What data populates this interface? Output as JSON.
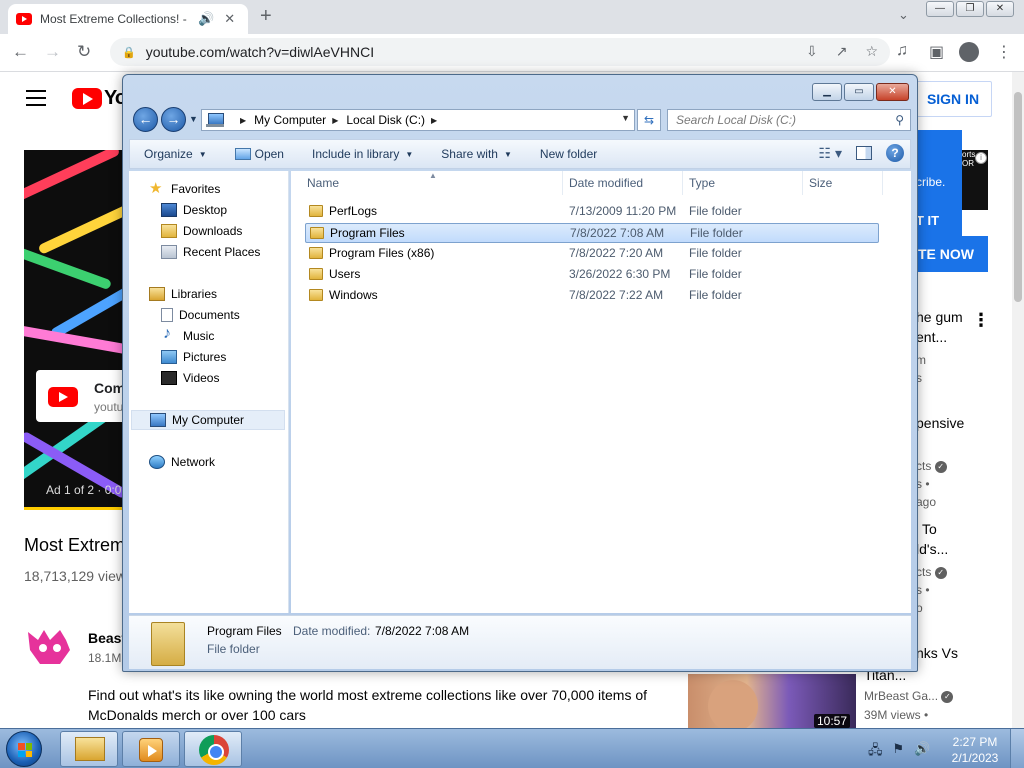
{
  "browser": {
    "tab_title": "Most Extreme Collections! -",
    "url": "youtube.com/watch?v=diwlAeVHNCI"
  },
  "youtube": {
    "sign_in": "SIGN IN",
    "logo_partial": "Yo",
    "ad_card_title": "Com",
    "ad_card_sub": "youtu",
    "ad_counter": "Ad 1 of 2 · 0:0",
    "video_title": "Most Extrem",
    "video_views": "18,713,129 view",
    "channel_name": "Beast",
    "channel_subs": "18.1M",
    "description": "Find out what's its like owning the world most extreme collections like over 70,000 items of McDonalds merch or over 100 cars",
    "ad_panel_info": "i",
    "ad_panel_thumb": "orts OR",
    "ad_panel_text": "cribe.",
    "ad_panel_cta": "T IT",
    "ad_panel_button": "TE NOW",
    "side": {
      "title1_line1": "he gum",
      "title1_line2": "ent...",
      "meta1a": "m",
      "meta1b": "s",
      "title2": "pensive",
      "meta2a": "cts",
      "meta2b": "s •",
      "meta2c": "ago",
      "title3_line1": "To",
      "title3_line2": "ld's...",
      "meta3a": "cts",
      "meta3b": "s •",
      "meta3c": "o",
      "title4": "nks Vs",
      "title4_cont": "Titan...",
      "channel4": "MrBeast Ga...",
      "views4": "39M views •",
      "duration4": "10:57"
    }
  },
  "explorer": {
    "breadcrumb": [
      "My Computer",
      "Local Disk (C:)"
    ],
    "search_placeholder": "Search Local Disk (C:)",
    "commands": {
      "organize": "Organize",
      "open": "Open",
      "include": "Include in library",
      "share": "Share with",
      "new_folder": "New folder"
    },
    "nav": {
      "favorites": "Favorites",
      "desktop": "Desktop",
      "downloads": "Downloads",
      "recent": "Recent Places",
      "libraries": "Libraries",
      "documents": "Documents",
      "music": "Music",
      "pictures": "Pictures",
      "videos": "Videos",
      "my_computer": "My Computer",
      "network": "Network"
    },
    "columns": {
      "name": "Name",
      "date": "Date modified",
      "type": "Type",
      "size": "Size"
    },
    "files": [
      {
        "name": "PerfLogs",
        "date": "7/13/2009 11:20 PM",
        "type": "File folder"
      },
      {
        "name": "Program Files",
        "date": "7/8/2022 7:08 AM",
        "type": "File folder"
      },
      {
        "name": "Program Files (x86)",
        "date": "7/8/2022 7:20 AM",
        "type": "File folder"
      },
      {
        "name": "Users",
        "date": "3/26/2022 6:30 PM",
        "type": "File folder"
      },
      {
        "name": "Windows",
        "date": "7/8/2022 7:22 AM",
        "type": "File folder"
      }
    ],
    "selected_index": 1,
    "details": {
      "name": "Program Files",
      "date_label": "Date modified:",
      "date_value": "7/8/2022 7:08 AM",
      "type": "File folder"
    }
  },
  "taskbar": {
    "time": "2:27 PM",
    "date": "2/1/2023"
  }
}
